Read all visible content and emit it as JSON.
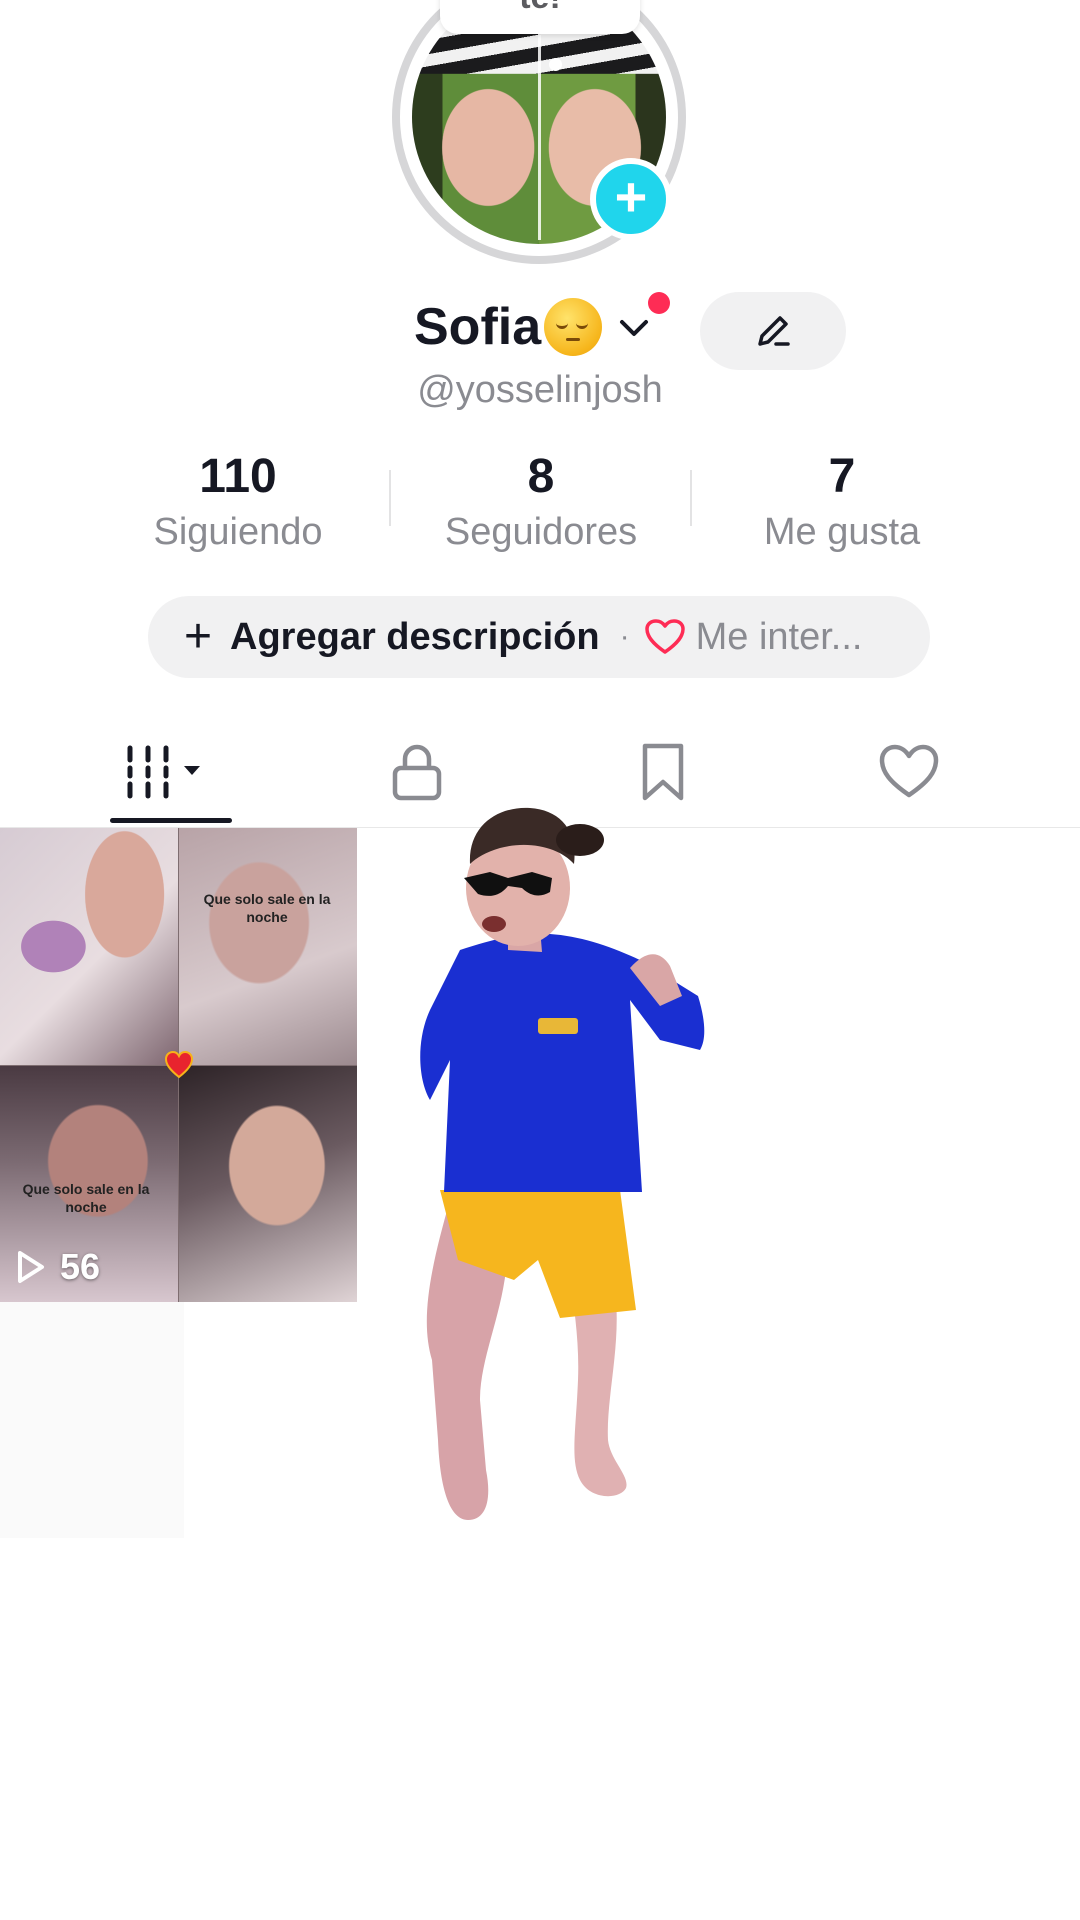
{
  "profile": {
    "bubble_text": "te!",
    "display_name": "Sofia",
    "username": "@yosselinjosh"
  },
  "stats": [
    {
      "value": "110",
      "label": "Siguiendo"
    },
    {
      "value": "8",
      "label": "Seguidores"
    },
    {
      "value": "7",
      "label": "Me gusta"
    }
  ],
  "description": {
    "add_label": "Agregar descripción",
    "separator": "·",
    "interests_label": "Me inter..."
  },
  "tabs": [
    "videos-grid-icon",
    "lock-icon",
    "bookmark-icon",
    "heart-icon"
  ],
  "videos": [
    {
      "overlay_text_top": "Que solo sale en la noche",
      "overlay_text_bottom": "Que solo sale en la noche",
      "views": "56"
    }
  ],
  "colors": {
    "accent_red": "#fe2c55",
    "add_button": "#20d5ec",
    "text_primary": "#161823",
    "text_secondary": "#8a8b91"
  }
}
